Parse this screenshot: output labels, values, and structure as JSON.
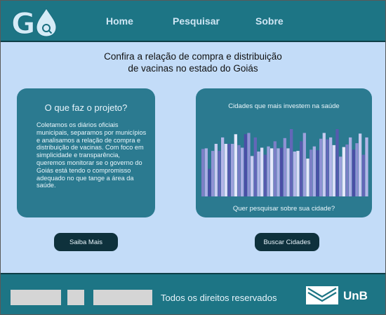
{
  "brand": {
    "logo_text": "G",
    "logo_icon": "water-drop-search-icon"
  },
  "nav": {
    "home": "Home",
    "search": "Pesquisar",
    "about": "Sobre"
  },
  "headline": {
    "line1": "Confira a relação de compra e distribuição",
    "line2": "de vacinas no estado do Goiás"
  },
  "about_card": {
    "title": "O que faz o projeto?",
    "text": "Coletamos os diários oficiais municipais, separamos por municípios e analisamos a relação de compra e distribuição de vacinas. Com foco em simplicidade e transparência, queremos monitorar se o governo do Goiás está tendo o compromisso adequado no que tange a área da saúde."
  },
  "chart_card": {
    "title": "Cidades que mais investem na saúde",
    "footer_link": "Quer pesquisar sobre sua cidade?"
  },
  "chart_data": {
    "type": "bar",
    "title": "Cidades que mais investem na saúde",
    "xlabel": "",
    "ylabel": "",
    "grid": false,
    "values": [
      0.74,
      0.75,
      0.43,
      0.71,
      0.82,
      0.71,
      0.92,
      0.82,
      0.82,
      0.82,
      0.97,
      0.8,
      0.76,
      0.97,
      0.99,
      0.63,
      0.92,
      0.7,
      0.76,
      0.65,
      0.78,
      0.75,
      0.86,
      0.75,
      0.76,
      0.91,
      0.75,
      1.05,
      0.7,
      0.71,
      0.86,
      0.99,
      0.59,
      0.73,
      0.78,
      0.72,
      0.9,
      0.99,
      0.89,
      0.92,
      0.8,
      1.05,
      0.62,
      0.77,
      0.81,
      0.92,
      0.73,
      0.83,
      0.98,
      0.65,
      0.92
    ],
    "colors": [
      "#7b7fc6",
      "#aaaee4",
      "#4a4fa6",
      "#8f92d4",
      "#c9ccf0",
      "#6367b8",
      "#b3b6e8",
      "#dcdff8",
      "#565bae",
      "#9da1dc",
      "#e7e9fb"
    ]
  },
  "buttons": {
    "more": "Saiba Mais",
    "cities": "Buscar Cidades"
  },
  "footer": {
    "rights": "Todos os direitos reservados",
    "unb": "UnB"
  },
  "colors": {
    "header_bg": "#1d7585",
    "page_bg": "#c3dcf8",
    "card_bg": "#2b7a90",
    "button_bg": "#0e313c"
  }
}
